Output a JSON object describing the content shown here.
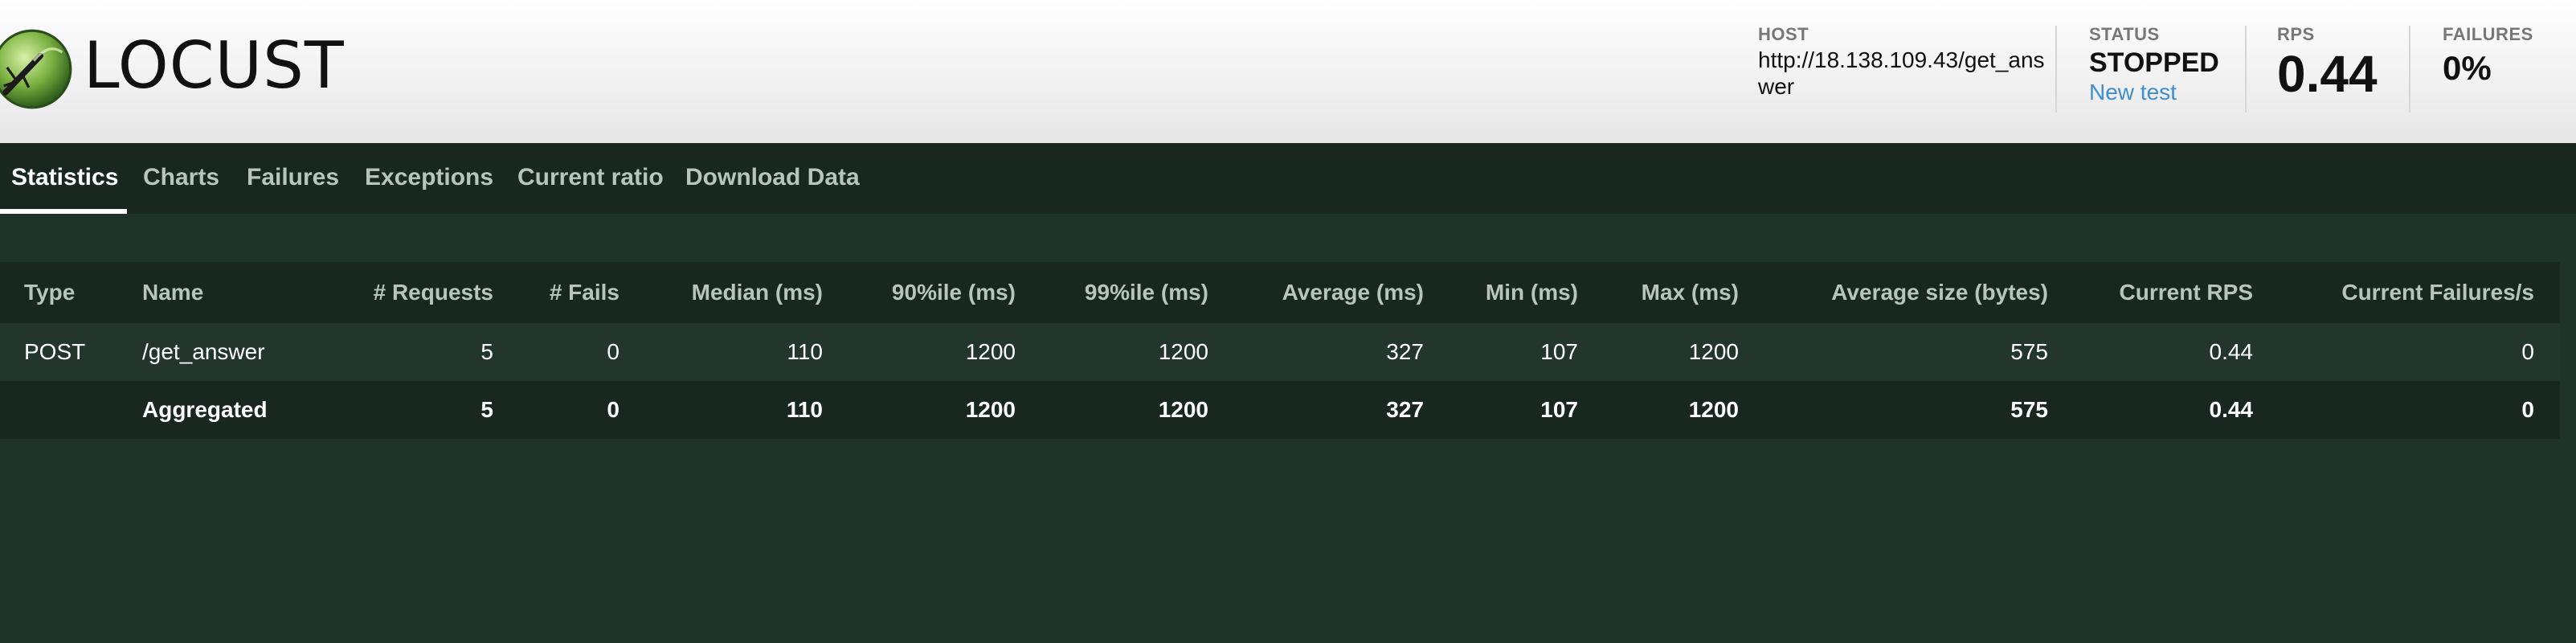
{
  "brand": {
    "logo_text": "LOCUST"
  },
  "header": {
    "host": {
      "label": "HOST",
      "value": "http://18.138.109.43/get_answer"
    },
    "status": {
      "label": "STATUS",
      "value": "STOPPED",
      "new_test": "New test"
    },
    "rps": {
      "label": "RPS",
      "value": "0.44"
    },
    "failures": {
      "label": "FAILURES",
      "value": "0%"
    }
  },
  "tabs": [
    {
      "label": "Statistics",
      "active": true
    },
    {
      "label": "Charts"
    },
    {
      "label": "Failures"
    },
    {
      "label": "Exceptions"
    },
    {
      "label": "Current ratio"
    },
    {
      "label": "Download Data"
    }
  ],
  "table": {
    "columns": [
      "Type",
      "Name",
      "# Requests",
      "# Fails",
      "Median (ms)",
      "90%ile (ms)",
      "99%ile (ms)",
      "Average (ms)",
      "Min (ms)",
      "Max (ms)",
      "Average size (bytes)",
      "Current RPS",
      "Current Failures/s"
    ],
    "rows": [
      [
        "POST",
        "/get_answer",
        "5",
        "0",
        "110",
        "1200",
        "1200",
        "327",
        "107",
        "1200",
        "575",
        "0.44",
        "0"
      ]
    ],
    "aggregated": [
      "",
      "Aggregated",
      "5",
      "0",
      "110",
      "1200",
      "1200",
      "327",
      "107",
      "1200",
      "575",
      "0.44",
      "0"
    ]
  },
  "colors": {
    "background": "#20332b",
    "tab_bar": "#18271f",
    "link": "#3f8fcd"
  }
}
